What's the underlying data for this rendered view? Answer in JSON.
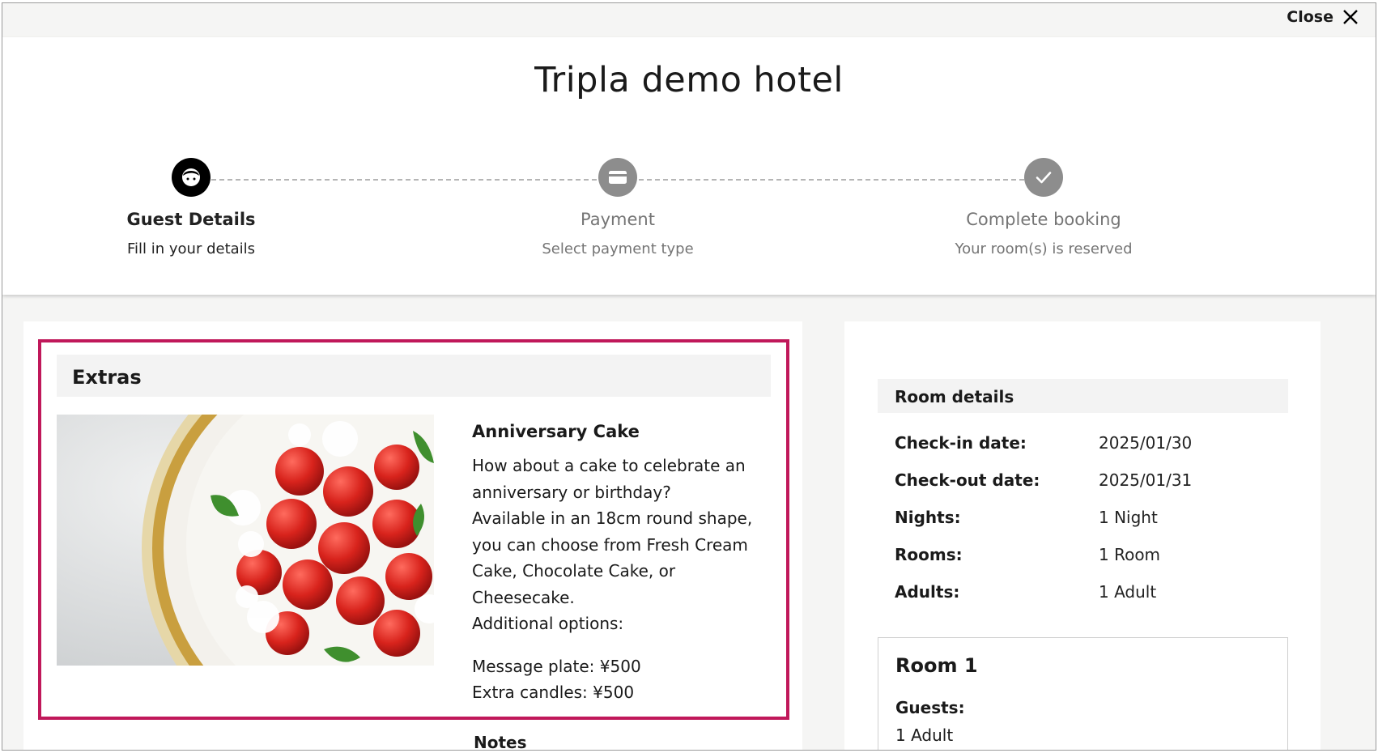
{
  "window": {
    "close_label": "Close"
  },
  "header": {
    "hotel_name": "Tripla demo hotel"
  },
  "steps": [
    {
      "title": "Guest Details",
      "subtitle": "Fill in your details",
      "state": "active",
      "icon": "guest-face-icon"
    },
    {
      "title": "Payment",
      "subtitle": "Select payment type",
      "state": "inactive",
      "icon": "credit-card-icon"
    },
    {
      "title": "Complete booking",
      "subtitle": "Your room(s) is reserved",
      "state": "inactive",
      "icon": "checkmark-icon"
    }
  ],
  "extras": {
    "heading": "Extras",
    "item": {
      "name": "Anniversary Cake",
      "description": "How about a cake to celebrate an\nanniversary or birthday?\nAvailable in an 18cm round shape,\nyou can choose from Fresh Cream\nCake, Chocolate Cake, or\nCheesecake.\nAdditional options:",
      "options": "Message plate: ¥500\nExtra candles: ¥500"
    },
    "notes_label": "Notes"
  },
  "room_details": {
    "heading": "Room details",
    "rows": [
      {
        "label": "Check-in date:",
        "value": "2025/01/30"
      },
      {
        "label": "Check-out date:",
        "value": "2025/01/31"
      },
      {
        "label": "Nights:",
        "value": "1 Night"
      },
      {
        "label": "Rooms:",
        "value": "1 Room"
      },
      {
        "label": "Adults:",
        "value": "1 Adult"
      }
    ],
    "room": {
      "title": "Room 1",
      "guests_label": "Guests:",
      "guests_value": "1 Adult"
    }
  },
  "colors": {
    "highlight": "#c0185a",
    "active_step": "#000000",
    "inactive_step": "#8d8d8d"
  }
}
